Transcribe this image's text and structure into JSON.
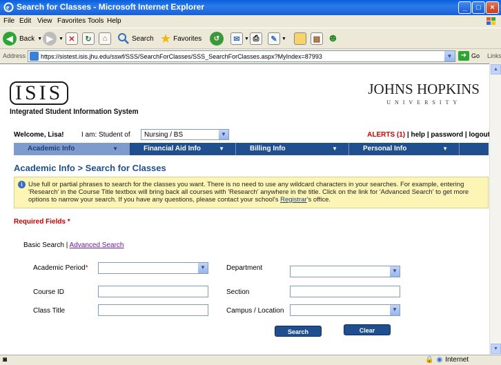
{
  "browser": {
    "window_title": "Search for Classes - Microsoft Internet Explorer",
    "menu": [
      "File",
      "Edit",
      "View",
      "Favorites",
      "Tools",
      "Help"
    ],
    "toolbar": {
      "back": "Back",
      "search": "Search",
      "favorites": "Favorites"
    },
    "address_label": "Address",
    "url": "https://sistest.isis.jhu.edu/sswf/SSS/SearchForClasses/SSS_SearchForClasses.aspx?MyIndex=87993",
    "go": "Go",
    "links": "Links",
    "status_zone": "Internet"
  },
  "header": {
    "isis_logo": "ISIS",
    "isis_subtitle": "Integrated Student Information System",
    "jhu_name": "JOHNS HOPKINS",
    "jhu_univ": "UNIVERSITY"
  },
  "user_bar": {
    "welcome": "Welcome, Lisa!",
    "iam_label": "I am: Student of",
    "program_selected": "Nursing / BS",
    "alerts": "ALERTS (1)",
    "help": "help",
    "password": "password",
    "logout": "logout"
  },
  "nav": [
    "Academic Info",
    "Financial Aid Info",
    "Billing Info",
    "Personal Info"
  ],
  "page": {
    "breadcrumb": "Academic Info > Search for Classes",
    "info_text_1": "Use full or partial phrases to search for the classes you want. There is no need to use any wildcard characters in your searches. For example, entering 'Research' in the Course Title textbox will bring back all courses with 'Research' anywhere in the title. Click on the link for 'Advanced Search' to get more options to narrow your search. If you have any questions, please contact your school's ",
    "info_link": "Registrar",
    "info_text_2": "'s office.",
    "required_fields": "Required Fields *",
    "basic_search": "Basic Search",
    "separator": " | ",
    "advanced_search": "Advanced Search"
  },
  "form": {
    "academic_period_label": "Academic Period",
    "academic_period_req": "*",
    "academic_period_value": "",
    "department_label": "Department",
    "department_value": "",
    "course_id_label": "Course ID",
    "section_label": "Section",
    "class_title_label": "Class Title",
    "campus_label": "Campus / Location",
    "campus_value": "",
    "search_button": "Search",
    "clear_button": "Clear"
  }
}
